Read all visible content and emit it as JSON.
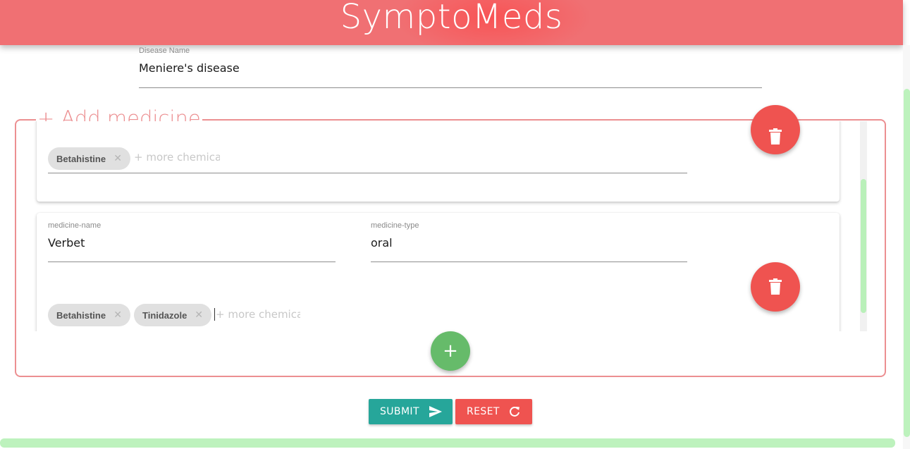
{
  "app": {
    "title": "SymptoMeds"
  },
  "disease": {
    "label": "Disease Name",
    "value": "Meniere's disease"
  },
  "medicine_section": {
    "legend": "+ Add medicine",
    "cards": [
      {
        "chips": [
          "Betahistine"
        ],
        "chip_placeholder": "+ more chemicals"
      },
      {
        "name_label": "medicine-name",
        "name_value": "Verbet",
        "type_label": "medicine-type",
        "type_value": "oral",
        "chips": [
          "Betahistine",
          "Tinidazole"
        ],
        "chip_placeholder": "+ more chemicals"
      }
    ],
    "add_button": "+"
  },
  "actions": {
    "submit": "SUBMIT",
    "reset": "RESET"
  },
  "icons": {
    "delete": "trash-icon",
    "chip_remove": "close-icon",
    "submit": "send-icon",
    "reset": "refresh-icon"
  },
  "colors": {
    "header": "#f07073",
    "accent": "#ec8f91",
    "submit": "#26a69a",
    "danger": "#ef5350",
    "add": "#66bb6a",
    "scrollbar": "#bdf2bd"
  }
}
